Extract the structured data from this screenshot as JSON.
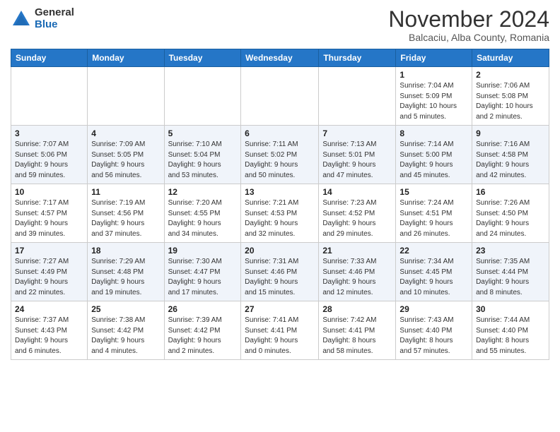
{
  "header": {
    "logo_general": "General",
    "logo_blue": "Blue",
    "month_title": "November 2024",
    "location": "Balcaciu, Alba County, Romania"
  },
  "weekdays": [
    "Sunday",
    "Monday",
    "Tuesday",
    "Wednesday",
    "Thursday",
    "Friday",
    "Saturday"
  ],
  "weeks": [
    [
      {
        "day": "",
        "info": ""
      },
      {
        "day": "",
        "info": ""
      },
      {
        "day": "",
        "info": ""
      },
      {
        "day": "",
        "info": ""
      },
      {
        "day": "",
        "info": ""
      },
      {
        "day": "1",
        "info": "Sunrise: 7:04 AM\nSunset: 5:09 PM\nDaylight: 10 hours\nand 5 minutes."
      },
      {
        "day": "2",
        "info": "Sunrise: 7:06 AM\nSunset: 5:08 PM\nDaylight: 10 hours\nand 2 minutes."
      }
    ],
    [
      {
        "day": "3",
        "info": "Sunrise: 7:07 AM\nSunset: 5:06 PM\nDaylight: 9 hours\nand 59 minutes."
      },
      {
        "day": "4",
        "info": "Sunrise: 7:09 AM\nSunset: 5:05 PM\nDaylight: 9 hours\nand 56 minutes."
      },
      {
        "day": "5",
        "info": "Sunrise: 7:10 AM\nSunset: 5:04 PM\nDaylight: 9 hours\nand 53 minutes."
      },
      {
        "day": "6",
        "info": "Sunrise: 7:11 AM\nSunset: 5:02 PM\nDaylight: 9 hours\nand 50 minutes."
      },
      {
        "day": "7",
        "info": "Sunrise: 7:13 AM\nSunset: 5:01 PM\nDaylight: 9 hours\nand 47 minutes."
      },
      {
        "day": "8",
        "info": "Sunrise: 7:14 AM\nSunset: 5:00 PM\nDaylight: 9 hours\nand 45 minutes."
      },
      {
        "day": "9",
        "info": "Sunrise: 7:16 AM\nSunset: 4:58 PM\nDaylight: 9 hours\nand 42 minutes."
      }
    ],
    [
      {
        "day": "10",
        "info": "Sunrise: 7:17 AM\nSunset: 4:57 PM\nDaylight: 9 hours\nand 39 minutes."
      },
      {
        "day": "11",
        "info": "Sunrise: 7:19 AM\nSunset: 4:56 PM\nDaylight: 9 hours\nand 37 minutes."
      },
      {
        "day": "12",
        "info": "Sunrise: 7:20 AM\nSunset: 4:55 PM\nDaylight: 9 hours\nand 34 minutes."
      },
      {
        "day": "13",
        "info": "Sunrise: 7:21 AM\nSunset: 4:53 PM\nDaylight: 9 hours\nand 32 minutes."
      },
      {
        "day": "14",
        "info": "Sunrise: 7:23 AM\nSunset: 4:52 PM\nDaylight: 9 hours\nand 29 minutes."
      },
      {
        "day": "15",
        "info": "Sunrise: 7:24 AM\nSunset: 4:51 PM\nDaylight: 9 hours\nand 26 minutes."
      },
      {
        "day": "16",
        "info": "Sunrise: 7:26 AM\nSunset: 4:50 PM\nDaylight: 9 hours\nand 24 minutes."
      }
    ],
    [
      {
        "day": "17",
        "info": "Sunrise: 7:27 AM\nSunset: 4:49 PM\nDaylight: 9 hours\nand 22 minutes."
      },
      {
        "day": "18",
        "info": "Sunrise: 7:29 AM\nSunset: 4:48 PM\nDaylight: 9 hours\nand 19 minutes."
      },
      {
        "day": "19",
        "info": "Sunrise: 7:30 AM\nSunset: 4:47 PM\nDaylight: 9 hours\nand 17 minutes."
      },
      {
        "day": "20",
        "info": "Sunrise: 7:31 AM\nSunset: 4:46 PM\nDaylight: 9 hours\nand 15 minutes."
      },
      {
        "day": "21",
        "info": "Sunrise: 7:33 AM\nSunset: 4:46 PM\nDaylight: 9 hours\nand 12 minutes."
      },
      {
        "day": "22",
        "info": "Sunrise: 7:34 AM\nSunset: 4:45 PM\nDaylight: 9 hours\nand 10 minutes."
      },
      {
        "day": "23",
        "info": "Sunrise: 7:35 AM\nSunset: 4:44 PM\nDaylight: 9 hours\nand 8 minutes."
      }
    ],
    [
      {
        "day": "24",
        "info": "Sunrise: 7:37 AM\nSunset: 4:43 PM\nDaylight: 9 hours\nand 6 minutes."
      },
      {
        "day": "25",
        "info": "Sunrise: 7:38 AM\nSunset: 4:42 PM\nDaylight: 9 hours\nand 4 minutes."
      },
      {
        "day": "26",
        "info": "Sunrise: 7:39 AM\nSunset: 4:42 PM\nDaylight: 9 hours\nand 2 minutes."
      },
      {
        "day": "27",
        "info": "Sunrise: 7:41 AM\nSunset: 4:41 PM\nDaylight: 9 hours\nand 0 minutes."
      },
      {
        "day": "28",
        "info": "Sunrise: 7:42 AM\nSunset: 4:41 PM\nDaylight: 8 hours\nand 58 minutes."
      },
      {
        "day": "29",
        "info": "Sunrise: 7:43 AM\nSunset: 4:40 PM\nDaylight: 8 hours\nand 57 minutes."
      },
      {
        "day": "30",
        "info": "Sunrise: 7:44 AM\nSunset: 4:40 PM\nDaylight: 8 hours\nand 55 minutes."
      }
    ]
  ]
}
